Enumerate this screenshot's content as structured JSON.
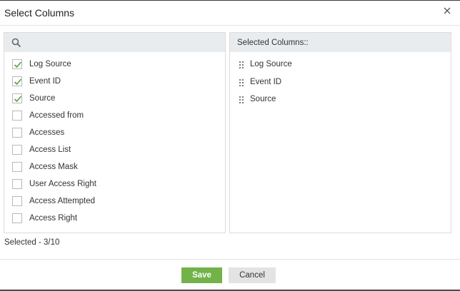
{
  "dialog": {
    "title": "Select Columns",
    "close_icon": "close-icon"
  },
  "search": {
    "placeholder": "",
    "icon": "search-icon"
  },
  "available_columns": [
    {
      "label": "Log Source",
      "checked": true
    },
    {
      "label": "Event ID",
      "checked": true
    },
    {
      "label": "Source",
      "checked": true
    },
    {
      "label": "Accessed from",
      "checked": false
    },
    {
      "label": "Accesses",
      "checked": false
    },
    {
      "label": "Access List",
      "checked": false
    },
    {
      "label": "Access Mask",
      "checked": false
    },
    {
      "label": "User Access Right",
      "checked": false
    },
    {
      "label": "Access Attempted",
      "checked": false
    },
    {
      "label": "Access Right",
      "checked": false
    }
  ],
  "selected_panel": {
    "header": "Selected Columns::",
    "items": [
      "Log Source",
      "Event ID",
      "Source"
    ]
  },
  "status": {
    "selected_count": "Selected - 3/10"
  },
  "footer": {
    "save_label": "Save",
    "cancel_label": "Cancel"
  },
  "colors": {
    "save_button": "#72b249",
    "check_mark": "#5a9e3a",
    "panel_header": "#e9ecef"
  }
}
